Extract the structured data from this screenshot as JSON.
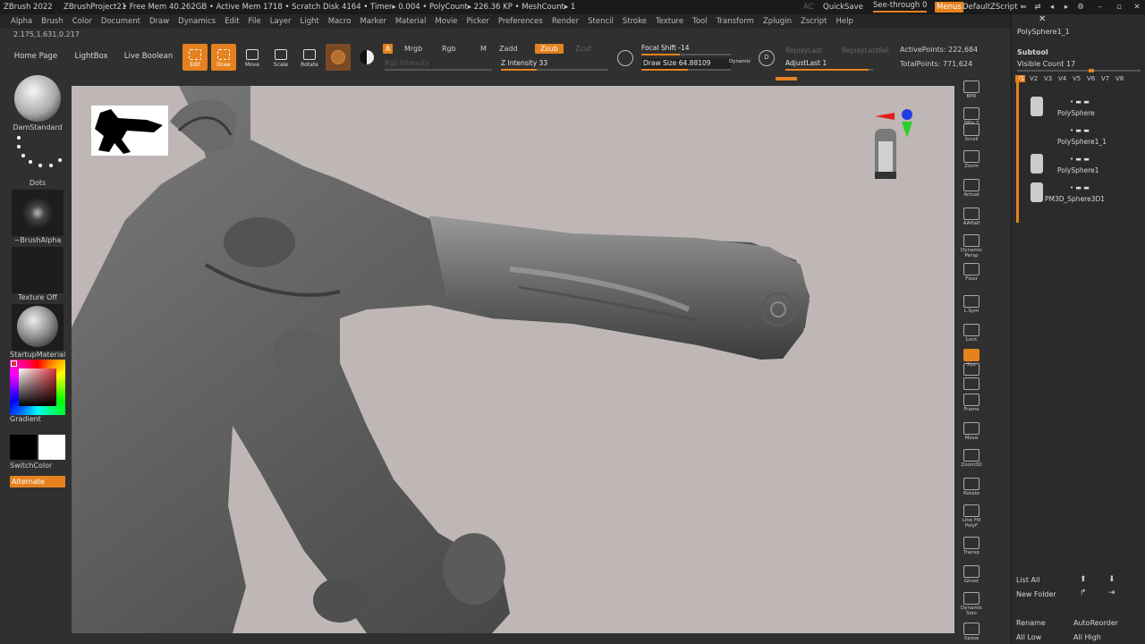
{
  "title_bar": {
    "app": "ZBrush 2022",
    "project": "ZBrushProject21",
    "stats": "• Free Mem 40.262GB • Active Mem 1718 • Scratch Disk 4164 • Timer▸ 0.004 • PolyCount▸ 226.36 KP • MeshCount▸ 1",
    "ac": "AC",
    "quicksave": "QuickSave",
    "see_through": "See-through  0",
    "menus": "Menus",
    "zscript": "DefaultZScript"
  },
  "menu_bar": [
    "Alpha",
    "Brush",
    "Color",
    "Document",
    "Draw",
    "Dynamics",
    "Edit",
    "File",
    "Layer",
    "Light",
    "Macro",
    "Marker",
    "Material",
    "Movie",
    "Picker",
    "Preferences",
    "Render",
    "Stencil",
    "Stroke",
    "Texture",
    "Tool",
    "Transform",
    "Zplugin",
    "Zscript",
    "Help"
  ],
  "coords": "2.175,1.631,0.217",
  "toolbar": {
    "home_page": "Home Page",
    "lightbox": "LightBox",
    "live_boolean": "Live Boolean",
    "edit": "Edit",
    "draw": "Draw",
    "move": "Move",
    "scale": "Scale",
    "rotate": "Rotate",
    "a": "A",
    "mrgb": "Mrgb",
    "rgb": "Rgb",
    "m": "M",
    "zadd": "Zadd",
    "zsub": "Zsub",
    "zcut": "Zcut",
    "rgb_intensity": "Rgb Intensity",
    "z_intensity": "Z Intensity 33",
    "focal_shift": "Focal Shift -14",
    "draw_size": "Draw Size 64.88109",
    "dynamic": "Dynamic",
    "d": "D",
    "replay_last": "ReplayLast",
    "replay_last_rel": "ReplayLastRel",
    "adjust_last": "AdjustLast 1",
    "active_points": "ActivePoints: 222,684",
    "total_points": "TotalPoints: 771,624"
  },
  "levels": {
    "z_intensity": 0.33,
    "draw_size": 0.52,
    "focal_shift": 0.43,
    "adjust_last": 0.95
  },
  "left_shelf": {
    "brush": "DamStandard",
    "stroke": "Dots",
    "alpha": "~BrushAlpha",
    "texture": "Texture Off",
    "material": "StartupMaterial",
    "gradient": "Gradient",
    "switch_color": "SwitchColor",
    "alternate": "Alternate"
  },
  "right_shelf": [
    "BPR",
    "SPix 3",
    "Scroll",
    "Zoom",
    "Actual",
    "AAHalf",
    "Dynamic Persp",
    "Floor",
    "L.Sym",
    "Lock",
    "Xyz",
    "",
    "",
    "Frame",
    "Move",
    "Zoom3D",
    "Rotate",
    "Line Fill PolyF",
    "Transp",
    "Ghost",
    "Dynamic Solo",
    "Xpose"
  ],
  "right_panel": {
    "top_item": "PolySphere1_1",
    "subtool": "Subtool",
    "visible_count": "Visible Count 17",
    "tabs": [
      "V1",
      "V2",
      "V3",
      "V4",
      "V5",
      "V6",
      "V7",
      "V8"
    ],
    "items": [
      "PolySphere",
      "PolySphere1_1",
      "PolySphere1",
      "PM3D_Sphere3D1"
    ],
    "list_all": "List All",
    "new_folder": "New Folder",
    "rename": "Rename",
    "auto_reorder": "AutoReorder",
    "all_low": "All Low",
    "all_high": "All High"
  },
  "colors": {
    "accent": "#e5821f",
    "viewport": "#bfb6b6",
    "panel": "#303030"
  }
}
